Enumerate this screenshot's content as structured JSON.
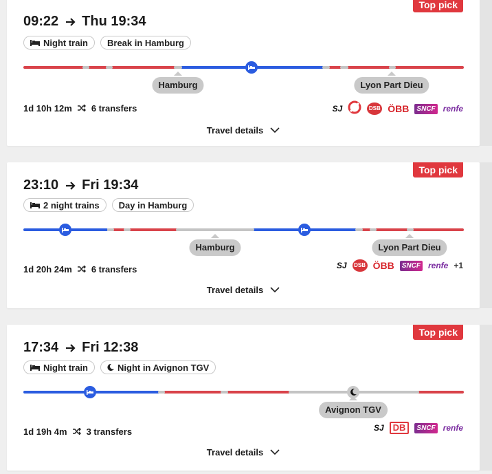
{
  "results": [
    {
      "badge": "Top pick",
      "depart": "09:22",
      "arrive": "Thu 19:34",
      "tags": [
        "Night train",
        "Break in Hamburg"
      ],
      "stops": [
        "Hamburg",
        "Lyon Part Dieu"
      ],
      "duration": "1d 10h 12m",
      "transfers": "6 transfers",
      "operators": [
        "SJ",
        "Öresundståg",
        "DSB",
        "ÖBB",
        "SNCF",
        "renfe"
      ],
      "details_label": "Travel details"
    },
    {
      "badge": "Top pick",
      "depart": "23:10",
      "arrive": "Fri 19:34",
      "tags": [
        "2 night trains",
        "Day in Hamburg"
      ],
      "stops": [
        "Hamburg",
        "Lyon Part Dieu"
      ],
      "duration": "1d 20h 24m",
      "transfers": "6 transfers",
      "operators": [
        "SJ",
        "DSB",
        "ÖBB",
        "SNCF",
        "renfe"
      ],
      "more_operators": "+1",
      "details_label": "Travel details"
    },
    {
      "badge": "Top pick",
      "depart": "17:34",
      "arrive": "Fri 12:38",
      "tags": [
        "Night train",
        "Night in Avignon TGV"
      ],
      "stops": [
        "Avignon TGV"
      ],
      "duration": "1d 19h 4m",
      "transfers": "3 transfers",
      "operators": [
        "SJ",
        "DB",
        "SNCF",
        "renfe"
      ],
      "details_label": "Travel details"
    }
  ],
  "colors": {
    "red": "#d9434a",
    "blue": "#2b5ce0",
    "gray": "#c4c4c4",
    "badge": "#e0383e"
  },
  "operator_labels": {
    "sj": "SJ",
    "dsb": "DSB",
    "obb": "ÖBB",
    "sncf": "SNCF",
    "renfe": "renfe",
    "db": "DB"
  }
}
